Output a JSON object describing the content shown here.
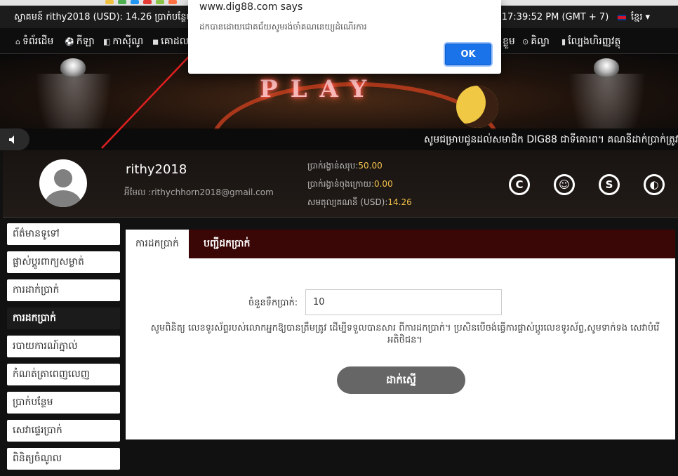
{
  "topbar": {
    "greeting": "ស្វាគមន៍ rithy2018  (USD): 14.26  ប្រាក់បន្ថែម : 0",
    "datetime": "2018 17:39:52 PM (GMT + 7)",
    "language": "ខ្មែរ ▾"
  },
  "nav": {
    "items": [
      {
        "icon": "⌂",
        "label": "ទំព័រដើម"
      },
      {
        "icon": "⚽",
        "label": "កីឡា"
      },
      {
        "icon": "◧",
        "label": "កាស៊ីណូ"
      },
      {
        "icon": "◼",
        "label": "គោដល"
      },
      {
        "icon": "",
        "label": "ខ្លួម"
      },
      {
        "icon": "⊙",
        "label": "គិល្វា"
      },
      {
        "icon": "▮",
        "label": "ល្បែងហិរញ្ញវត្ថុ"
      }
    ]
  },
  "banner": {
    "logo_text": "PLAY"
  },
  "marquee": {
    "text": "សូមជម្រាបជូនដល់សមាជិក DIG88 ជាទីគោរព។ គណនីដាក់ប្រាក់ត្រូវបា"
  },
  "profile": {
    "username": "rithy2018",
    "email": "អ៊ីមែល :rithychhorn2018@gmail.com",
    "stats": [
      {
        "label": "ប្រាក់រង្វាន់សរុប:",
        "value": "50.00"
      },
      {
        "label": "ប្រាក់រង្វាន់ចុងក្រោយ:",
        "value": "0.00"
      },
      {
        "label": "សមតុល្យគណនី (USD):",
        "value": "14.26"
      }
    ],
    "icons": [
      "C",
      "☺",
      "S",
      "◐"
    ]
  },
  "sidebar": {
    "items": [
      {
        "label": "ព័ត៌មានទូទៅ",
        "active": false
      },
      {
        "label": "ផ្លាស់ប្តូរពាក្យសម្ងាត់",
        "active": false
      },
      {
        "label": "ការដាក់ប្រាក់",
        "active": false
      },
      {
        "label": "ការដកប្រាក់",
        "active": true
      },
      {
        "label": "របាយការណ៍ភ្នាល់",
        "active": false
      },
      {
        "label": "កំណត់ត្រាពេញលេញ",
        "active": false
      },
      {
        "label": "ប្រាក់បន្ថែម",
        "active": false
      },
      {
        "label": "សេវាផ្ទេរប្រាក់",
        "active": false
      },
      {
        "label": "ពិនិត្យចំណូល",
        "active": false
      }
    ]
  },
  "withdraw": {
    "tabs": [
      "ការដកប្រាក់",
      "បញ្ជីដកប្រាក់"
    ],
    "amount_label": "ចំនួនទឹកប្រាក់:",
    "amount_value": "10",
    "note": "សូមពិនិត្យ លេខទូរស័ព្ទរបស់លោកអ្នកឱ្យបានត្រឹមត្រូវ ដើម្បីទទួលបានសារ ពីការដកប្រាក់។ ប្រសិនបើចង់ធ្វើការផ្លាស់ប្តូរលេខទូរស័ព្ទ,សូមទាក់ទង សេវាបំរើអតិថិជន។",
    "submit_label": "ដាក់ស្នើ"
  },
  "dialog": {
    "title": "www.dig88.com says",
    "message": "ដកបានដោយជោគជ័យសូមរង់ចាំគណនេយ្យដំណើរការ",
    "ok_label": "OK"
  },
  "colors": {
    "accent_gold": "#f2c14b",
    "tab_bar": "#3a0606",
    "dialog_button": "#1a73e8",
    "arrow": "#e02020"
  }
}
